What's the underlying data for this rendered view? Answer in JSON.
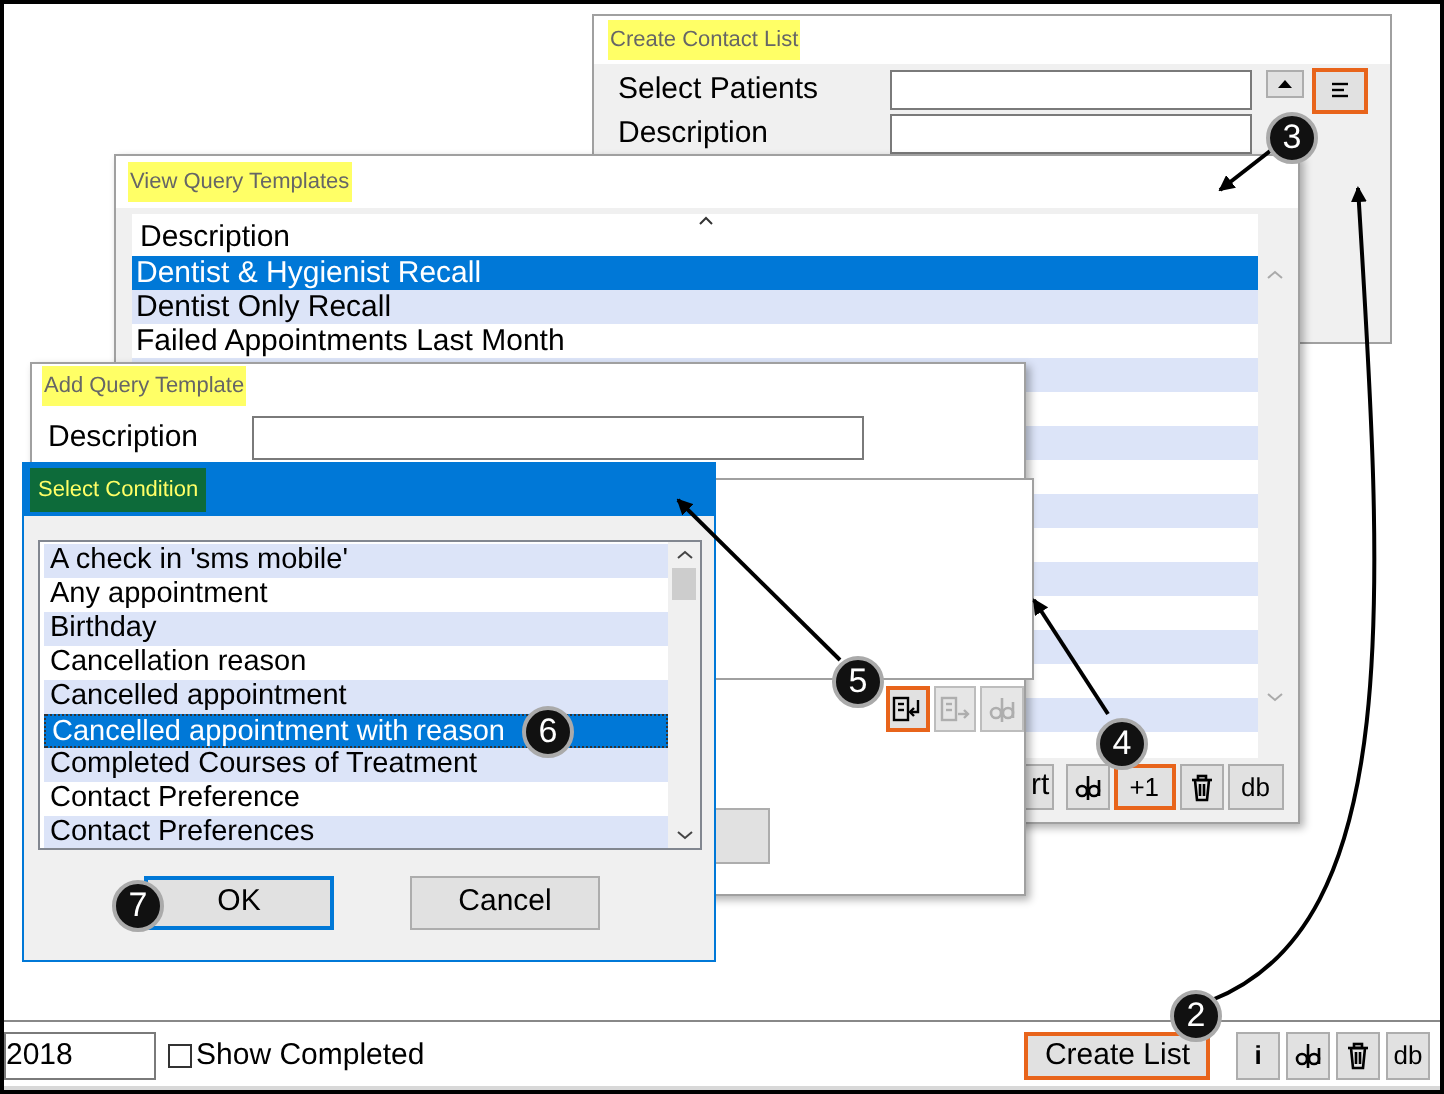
{
  "create_contact_list": {
    "title": "Create Contact List",
    "fields": [
      {
        "label": "Select Patients"
      },
      {
        "label": "Description"
      }
    ],
    "buttons": [
      {
        "kind": "lines",
        "highlighted": true
      }
    ]
  },
  "view_query_templates": {
    "title": "View Query Templates",
    "column": "Description",
    "rows": [
      {
        "text": "Dentist & Hygienist Recall",
        "selected": true
      },
      {
        "text": "Dentist Only Recall",
        "selected": false
      },
      {
        "text": "Failed Appointments Last Month",
        "selected": false
      }
    ],
    "buttons": [
      {
        "kind": "text",
        "label": "rt",
        "highlighted": false
      },
      {
        "kind": "edit",
        "highlighted": false
      },
      {
        "kind": "text",
        "label": "+1",
        "highlighted": true
      },
      {
        "kind": "trash",
        "highlighted": false
      },
      {
        "kind": "text",
        "label": "db",
        "highlighted": false
      }
    ]
  },
  "add_query_template": {
    "title": "Add Query Template",
    "description_label": "Description",
    "buttons": [
      {
        "kind": "insert",
        "highlighted": true,
        "disabled": false
      },
      {
        "kind": "append",
        "highlighted": false,
        "disabled": true
      },
      {
        "kind": "edit",
        "highlighted": false,
        "disabled": true
      }
    ]
  },
  "select_condition": {
    "title": "Select Condition",
    "items": [
      {
        "text": "A check in 'sms mobile'",
        "selected": false
      },
      {
        "text": "Any appointment",
        "selected": false
      },
      {
        "text": "Birthday",
        "selected": false
      },
      {
        "text": "Cancellation reason",
        "selected": false
      },
      {
        "text": "Cancelled appointment",
        "selected": false
      },
      {
        "text": "Cancelled appointment with reason",
        "selected": true
      },
      {
        "text": "Completed Courses of Treatment",
        "selected": false
      },
      {
        "text": "Contact Preference",
        "selected": false
      },
      {
        "text": "Contact Preferences",
        "selected": false
      }
    ],
    "buttons": [
      {
        "label": "OK",
        "default": true
      },
      {
        "label": "Cancel",
        "default": false
      }
    ]
  },
  "status_bar": {
    "date": "2018",
    "show_completed": {
      "label": "Show Completed",
      "checked": false
    },
    "buttons": [
      {
        "kind": "text",
        "label": "Create List",
        "highlighted": true
      },
      {
        "kind": "text",
        "label": "i",
        "highlighted": false
      },
      {
        "kind": "edit",
        "highlighted": false
      },
      {
        "kind": "trash",
        "highlighted": false
      },
      {
        "kind": "text",
        "label": "db",
        "highlighted": false
      }
    ]
  },
  "callouts": [
    {
      "number": "2"
    },
    {
      "number": "3"
    },
    {
      "number": "4"
    },
    {
      "number": "5"
    },
    {
      "number": "6"
    },
    {
      "number": "7"
    }
  ]
}
